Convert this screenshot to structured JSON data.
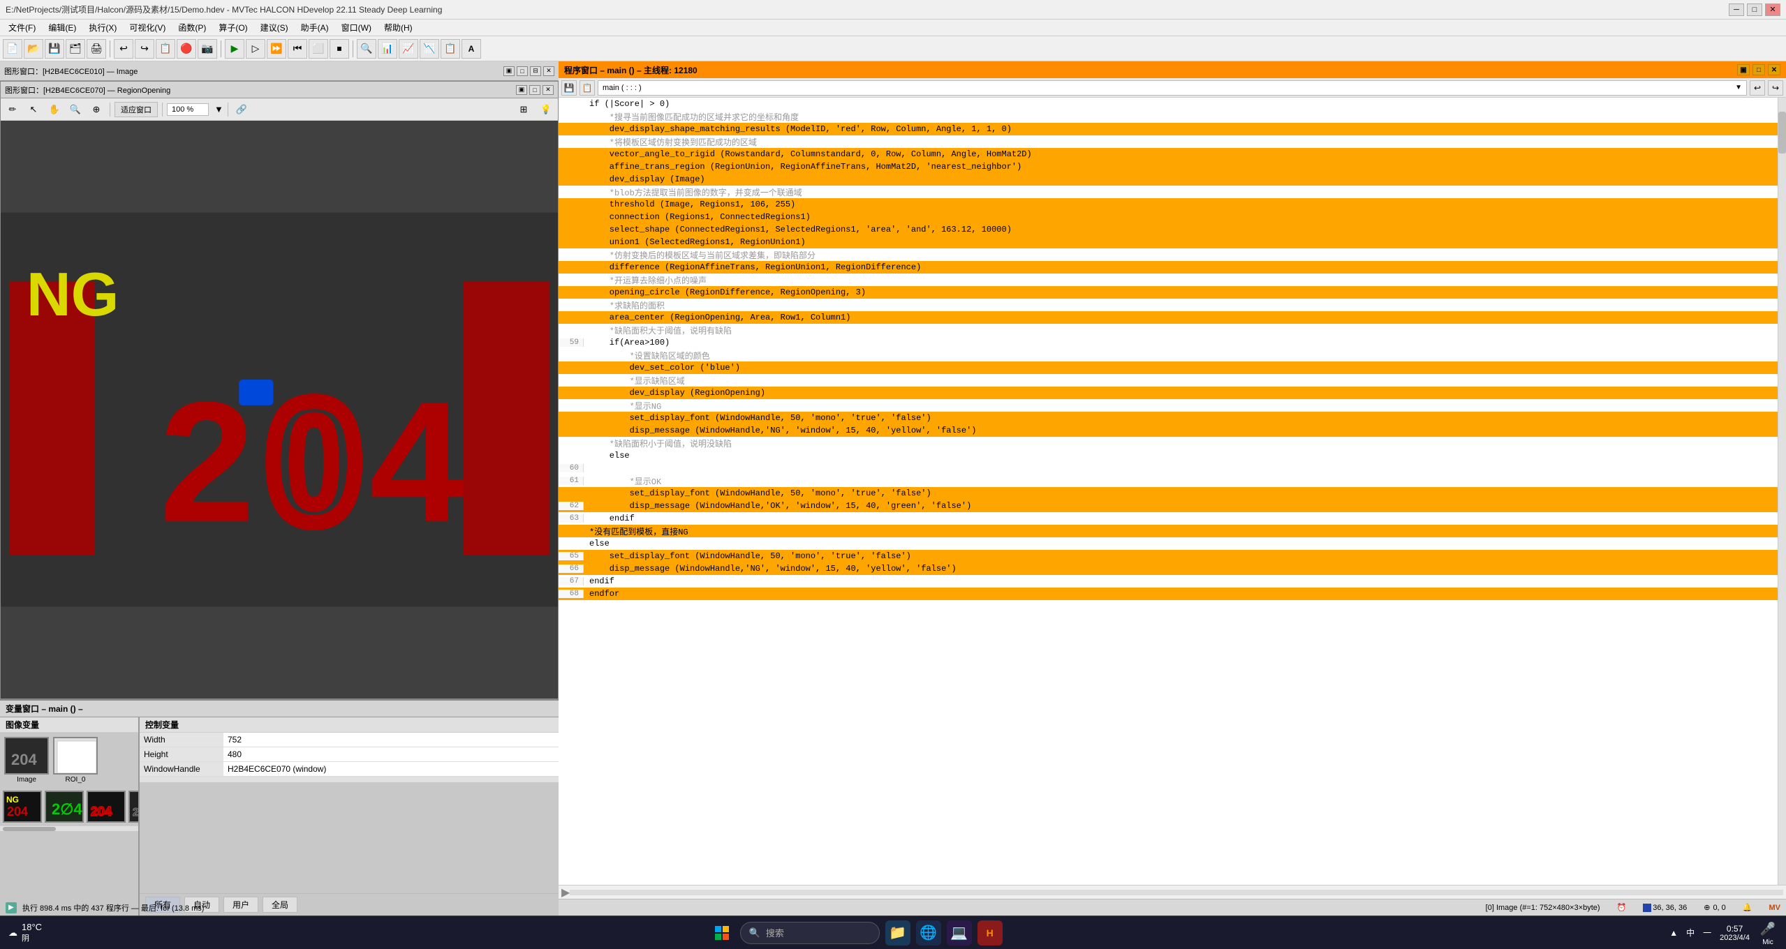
{
  "window": {
    "title": "E:/NetProjects/测试项目/Halcon/源码及素材/15/Demo.hdev - MVTec HALCON HDevelop 22.11 Steady Deep Learning",
    "controls": [
      "─",
      "□",
      "✕"
    ]
  },
  "menu": {
    "items": [
      "文件(F)",
      "编辑(E)",
      "执行(X)",
      "可视化(V)",
      "函数(P)",
      "算子(O)",
      "建议(S)",
      "助手(A)",
      "窗口(W)",
      "帮助(H)"
    ]
  },
  "image_window_top": {
    "title": "图形窗口：[H2B4EC6CE010] — Image",
    "controls": [
      "▣",
      "□",
      "⊟",
      "✕"
    ]
  },
  "region_window": {
    "title": "图形窗口：[H2B4EC6CE070] — RegionOpening",
    "controls": [
      "▣",
      "□",
      "⊟",
      "✕"
    ],
    "fit_btn": "适应窗口",
    "zoom": "100 %"
  },
  "code_header": {
    "title": "程序窗口 – main () – 主线程: 12180",
    "controls": [
      "▣",
      "□",
      "✕"
    ]
  },
  "code": {
    "lines": [
      {
        "num": "",
        "text": "if (|Score| > 0)",
        "highlighted": false,
        "comment": false
      },
      {
        "num": "",
        "text": "    *搜寻当前图像匹配成功的区域并求它的坐标和角度",
        "highlighted": false,
        "comment": true
      },
      {
        "num": "",
        "text": "    dev_display_shape_matching_results (ModelID, 'red', Row, Column, Angle, 1, 1, 0)",
        "highlighted": true,
        "comment": false
      },
      {
        "num": "",
        "text": "    *将模板区域仿射变换到匹配成功的区域",
        "highlighted": false,
        "comment": true
      },
      {
        "num": "",
        "text": "    vector_angle_to_rigid (Rowstandard, Columnstandard, 0, Row, Column, Angle, HomMat2D)",
        "highlighted": true,
        "comment": false
      },
      {
        "num": "",
        "text": "    affine_trans_region (RegionUnion, RegionAffineTrans, HomMat2D, 'nearest_neighbor')",
        "highlighted": true,
        "comment": false
      },
      {
        "num": "",
        "text": "    dev_display (Image)",
        "highlighted": true,
        "comment": false
      },
      {
        "num": "",
        "text": "    *blob方法提取当前图像的数字，并变成一个联通域",
        "highlighted": false,
        "comment": true
      },
      {
        "num": "",
        "text": "    threshold (Image, Regions1, 106, 255)",
        "highlighted": true,
        "comment": false
      },
      {
        "num": "",
        "text": "    connection (Regions1, ConnectedRegions1)",
        "highlighted": true,
        "comment": false
      },
      {
        "num": "",
        "text": "    select_shape (ConnectedRegions1, SelectedRegions1, 'area', 'and', 163.12, 10000)",
        "highlighted": true,
        "comment": false
      },
      {
        "num": "",
        "text": "    union1 (SelectedRegions1, RegionUnion1)",
        "highlighted": true,
        "comment": false
      },
      {
        "num": "",
        "text": "    *仿射变换后的模板区域与当前区域求差集，即缺陷部分",
        "highlighted": false,
        "comment": true
      },
      {
        "num": "",
        "text": "    difference (RegionAffineTrans, RegionUnion1, RegionDifference)",
        "highlighted": true,
        "comment": false
      },
      {
        "num": "",
        "text": "    *开运算去除细小点的噪声",
        "highlighted": false,
        "comment": true
      },
      {
        "num": "",
        "text": "    opening_circle (RegionDifference, RegionOpening, 3)",
        "highlighted": true,
        "comment": false
      },
      {
        "num": "",
        "text": "    *求缺陷的面积",
        "highlighted": false,
        "comment": true
      },
      {
        "num": "",
        "text": "    area_center (RegionOpening, Area, Row1, Column1)",
        "highlighted": true,
        "comment": false
      },
      {
        "num": "",
        "text": "    *缺陷面积大于阈值，说明有缺陷",
        "highlighted": false,
        "comment": true
      },
      {
        "num": "59",
        "text": "    if(Area>100)",
        "highlighted": false,
        "comment": false
      },
      {
        "num": "",
        "text": "        *设置缺陷区域的颜色",
        "highlighted": false,
        "comment": true
      },
      {
        "num": "",
        "text": "        dev_set_color ('blue')",
        "highlighted": true,
        "comment": false
      },
      {
        "num": "",
        "text": "        *显示缺陷区域",
        "highlighted": false,
        "comment": true
      },
      {
        "num": "",
        "text": "        dev_display (RegionOpening)",
        "highlighted": true,
        "comment": false
      },
      {
        "num": "",
        "text": "        *显示NG",
        "highlighted": false,
        "comment": true
      },
      {
        "num": "",
        "text": "        set_display_font (WindowHandle, 50, 'mono', 'true', 'false')",
        "highlighted": true,
        "comment": false
      },
      {
        "num": "",
        "text": "        disp_message (WindowHandle,'NG', 'window', 15, 40, 'yellow', 'false')",
        "highlighted": true,
        "comment": false
      },
      {
        "num": "",
        "text": "    *缺陷面积小于阈值，说明没缺陷",
        "highlighted": false,
        "comment": true
      },
      {
        "num": "",
        "text": "    else",
        "highlighted": false,
        "comment": false
      },
      {
        "num": "60",
        "text": "",
        "highlighted": false,
        "comment": false
      },
      {
        "num": "61",
        "text": "        *显示OK",
        "highlighted": false,
        "comment": true
      },
      {
        "num": "",
        "text": "        set_display_font (WindowHandle, 50, 'mono', 'true', 'false')",
        "highlighted": true,
        "comment": false
      },
      {
        "num": "62",
        "text": "        disp_message (WindowHandle,'OK', 'window', 15, 40, 'green', 'false')",
        "highlighted": true,
        "comment": false
      },
      {
        "num": "63",
        "text": "    endif",
        "highlighted": false,
        "comment": false
      },
      {
        "num": "",
        "text": "*没有匹配到模板，直接NG",
        "highlighted": true,
        "comment": false
      },
      {
        "num": "",
        "text": "else",
        "highlighted": false,
        "comment": false
      },
      {
        "num": "65",
        "text": "    set_display_font (WindowHandle, 50, 'mono', 'true', 'false')",
        "highlighted": true,
        "comment": false
      },
      {
        "num": "66",
        "text": "    disp_message (WindowHandle,'NG', 'window', 15, 40, 'yellow', 'false')",
        "highlighted": true,
        "comment": false
      },
      {
        "num": "67",
        "text": "endif",
        "highlighted": false,
        "comment": false
      },
      {
        "num": "68",
        "text": "endfor",
        "highlighted": true,
        "comment": false
      }
    ]
  },
  "var_window": {
    "title": "变量窗口 – main () –",
    "image_section_label": "图像变量",
    "ctrl_section_label": "控制变量",
    "thumbnails": [
      {
        "label": "Image",
        "type": "gray"
      },
      {
        "label": "ROI_0",
        "type": "white"
      }
    ],
    "thumbnail_row": [
      {
        "label": "",
        "type": "204_red"
      },
      {
        "label": "",
        "type": "green"
      },
      {
        "label": "",
        "type": "204_outline"
      },
      {
        "label": "",
        "type": "204_small"
      },
      {
        "label": "",
        "type": "white_blob"
      }
    ],
    "ctrl_vars": [
      {
        "name": "Width",
        "value": "752"
      },
      {
        "name": "Height",
        "value": "480"
      },
      {
        "name": "WindowHandle",
        "value": "H2B4EC6CE070 (window)"
      }
    ],
    "filter_buttons": [
      "所有",
      "自动",
      "用户",
      "全局"
    ]
  },
  "status": {
    "execution": "执行 898.4 ms 中的 437 程序行 — 最后: for (13.8 ms)",
    "image_info": "[0] Image (#=1: 752×480×3×byte)",
    "coords": "36, 36, 36",
    "mouse_coords": "0, 0"
  },
  "taskbar": {
    "weather": "18°C",
    "weather_desc": "阴",
    "search_placeholder": "搜索",
    "time": "0:57",
    "date": "2023/4/4",
    "system_tray": [
      "▲",
      "中",
      "一"
    ],
    "mic_label": "Mic"
  }
}
